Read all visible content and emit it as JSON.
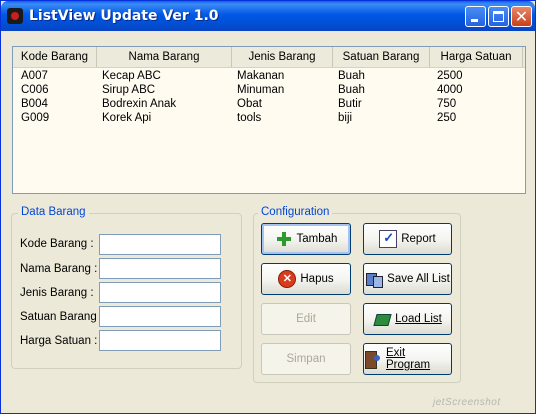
{
  "window": {
    "title": "ListView Update Ver 1.0"
  },
  "listview": {
    "columns": [
      "Kode Barang",
      "Nama Barang",
      "Jenis Barang",
      "Satuan Barang",
      "Harga Satuan"
    ],
    "rows": [
      [
        "A007",
        "Kecap ABC",
        "Makanan",
        "Buah",
        "2500"
      ],
      [
        "C006",
        "Sirup ABC",
        "Minuman",
        "Buah",
        "4000"
      ],
      [
        "B004",
        "Bodrexin Anak",
        "Obat",
        "Butir",
        "750"
      ],
      [
        "G009",
        "Korek Api",
        "tools",
        "biji",
        "250"
      ]
    ]
  },
  "data_barang": {
    "title": "Data Barang",
    "fields": [
      {
        "label": "Kode Barang :",
        "value": ""
      },
      {
        "label": "Nama Barang :",
        "value": ""
      },
      {
        "label": "Jenis Barang :",
        "value": ""
      },
      {
        "label": "Satuan Barang :",
        "value": ""
      },
      {
        "label": "Harga Satuan :",
        "value": ""
      }
    ]
  },
  "configuration": {
    "title": "Configuration",
    "buttons": {
      "tambah": "Tambah",
      "report": "Report",
      "hapus": "Hapus",
      "save_all": "Save All List",
      "edit": "Edit",
      "load_list": "Load List",
      "simpan": "Simpan",
      "exit": "Exit Program"
    }
  },
  "watermark": "jetScreenshot",
  "icons": {
    "app": "app-icon",
    "tambah": "plus-icon",
    "hapus": "delete-icon",
    "report": "report-icon",
    "save_all": "save-all-icon",
    "load_list": "load-list-icon",
    "exit": "exit-icon"
  }
}
